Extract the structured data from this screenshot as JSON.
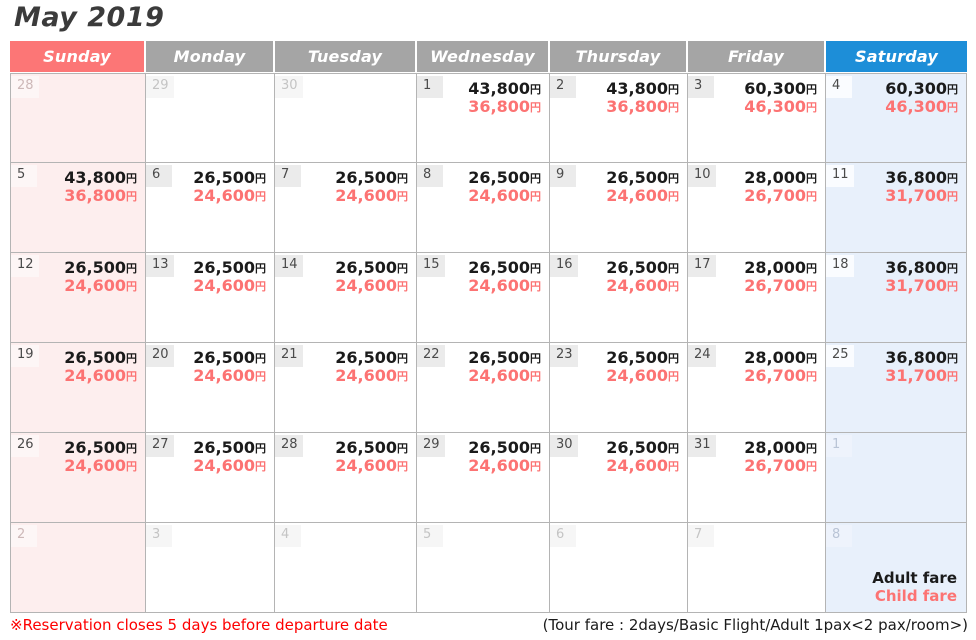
{
  "title": "May 2019",
  "colors": {
    "sunday_header": "#fc7676",
    "saturday_header": "#1d8ed8",
    "weekday_header": "#a5a5a5",
    "adult_fare": "#1b1b1b",
    "child_fare": "#fc7373",
    "notice": "#fe0000",
    "sunday_cell": "#fdeeee",
    "saturday_cell": "#e8f0fb"
  },
  "weekdays": [
    {
      "label": "Sunday",
      "kind": "sun"
    },
    {
      "label": "Monday",
      "kind": "wd"
    },
    {
      "label": "Tuesday",
      "kind": "wd"
    },
    {
      "label": "Wednesday",
      "kind": "wd"
    },
    {
      "label": "Thursday",
      "kind": "wd"
    },
    {
      "label": "Friday",
      "kind": "wd"
    },
    {
      "label": "Saturday",
      "kind": "sat"
    }
  ],
  "currency_symbol": "円",
  "weeks": [
    [
      {
        "day": "28",
        "out": true,
        "adult": "",
        "child": ""
      },
      {
        "day": "29",
        "out": true,
        "adult": "",
        "child": ""
      },
      {
        "day": "30",
        "out": true,
        "adult": "",
        "child": ""
      },
      {
        "day": "1",
        "out": false,
        "adult": "43,800",
        "child": "36,800"
      },
      {
        "day": "2",
        "out": false,
        "adult": "43,800",
        "child": "36,800"
      },
      {
        "day": "3",
        "out": false,
        "adult": "60,300",
        "child": "46,300"
      },
      {
        "day": "4",
        "out": false,
        "adult": "60,300",
        "child": "46,300"
      }
    ],
    [
      {
        "day": "5",
        "out": false,
        "adult": "43,800",
        "child": "36,800"
      },
      {
        "day": "6",
        "out": false,
        "adult": "26,500",
        "child": "24,600"
      },
      {
        "day": "7",
        "out": false,
        "adult": "26,500",
        "child": "24,600"
      },
      {
        "day": "8",
        "out": false,
        "adult": "26,500",
        "child": "24,600"
      },
      {
        "day": "9",
        "out": false,
        "adult": "26,500",
        "child": "24,600"
      },
      {
        "day": "10",
        "out": false,
        "adult": "28,000",
        "child": "26,700"
      },
      {
        "day": "11",
        "out": false,
        "adult": "36,800",
        "child": "31,700"
      }
    ],
    [
      {
        "day": "12",
        "out": false,
        "adult": "26,500",
        "child": "24,600"
      },
      {
        "day": "13",
        "out": false,
        "adult": "26,500",
        "child": "24,600"
      },
      {
        "day": "14",
        "out": false,
        "adult": "26,500",
        "child": "24,600"
      },
      {
        "day": "15",
        "out": false,
        "adult": "26,500",
        "child": "24,600"
      },
      {
        "day": "16",
        "out": false,
        "adult": "26,500",
        "child": "24,600"
      },
      {
        "day": "17",
        "out": false,
        "adult": "28,000",
        "child": "26,700"
      },
      {
        "day": "18",
        "out": false,
        "adult": "36,800",
        "child": "31,700"
      }
    ],
    [
      {
        "day": "19",
        "out": false,
        "adult": "26,500",
        "child": "24,600"
      },
      {
        "day": "20",
        "out": false,
        "adult": "26,500",
        "child": "24,600"
      },
      {
        "day": "21",
        "out": false,
        "adult": "26,500",
        "child": "24,600"
      },
      {
        "day": "22",
        "out": false,
        "adult": "26,500",
        "child": "24,600"
      },
      {
        "day": "23",
        "out": false,
        "adult": "26,500",
        "child": "24,600"
      },
      {
        "day": "24",
        "out": false,
        "adult": "28,000",
        "child": "26,700"
      },
      {
        "day": "25",
        "out": false,
        "adult": "36,800",
        "child": "31,700"
      }
    ],
    [
      {
        "day": "26",
        "out": false,
        "adult": "26,500",
        "child": "24,600"
      },
      {
        "day": "27",
        "out": false,
        "adult": "26,500",
        "child": "24,600"
      },
      {
        "day": "28",
        "out": false,
        "adult": "26,500",
        "child": "24,600"
      },
      {
        "day": "29",
        "out": false,
        "adult": "26,500",
        "child": "24,600"
      },
      {
        "day": "30",
        "out": false,
        "adult": "26,500",
        "child": "24,600"
      },
      {
        "day": "31",
        "out": false,
        "adult": "28,000",
        "child": "26,700"
      },
      {
        "day": "1",
        "out": true,
        "adult": "",
        "child": ""
      }
    ],
    [
      {
        "day": "2",
        "out": true,
        "adult": "",
        "child": ""
      },
      {
        "day": "3",
        "out": true,
        "adult": "",
        "child": ""
      },
      {
        "day": "4",
        "out": true,
        "adult": "",
        "child": ""
      },
      {
        "day": "5",
        "out": true,
        "adult": "",
        "child": ""
      },
      {
        "day": "6",
        "out": true,
        "adult": "",
        "child": ""
      },
      {
        "day": "7",
        "out": true,
        "adult": "",
        "child": ""
      },
      {
        "day": "8",
        "out": true,
        "adult": "",
        "child": "",
        "legend": true
      }
    ]
  ],
  "legend": {
    "adult_label": "Adult fare",
    "child_label": "Child fare"
  },
  "footer": {
    "notice": "※Reservation closes 5 days before departure date",
    "tour_fare": "(Tour fare : 2days/Basic Flight/Adult 1pax<2 pax/room>)"
  }
}
